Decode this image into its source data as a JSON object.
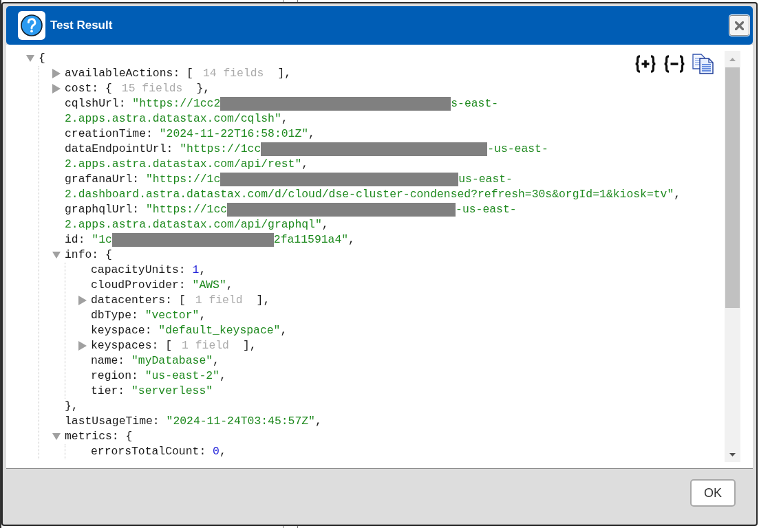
{
  "dialog": {
    "title": "Test Result",
    "tree": {
      "kind": "branch",
      "expanded": true,
      "open": "{",
      "children": [
        {
          "kind": "branch",
          "key": "availableActions:",
          "expanded": false,
          "open": "[",
          "hint": "14 fields",
          "close": "],"
        },
        {
          "kind": "branch",
          "key": "cost:",
          "expanded": false,
          "open": "{",
          "hint": "15 fields",
          "close": "},"
        },
        {
          "kind": "string",
          "key": "cqlshUrl:",
          "lines": [
            [
              {
                "kind": "text",
                "text": "\"https://1cc2"
              },
              {
                "kind": "redaction"
              },
              {
                "kind": "text",
                "text": "s-east-"
              }
            ],
            [
              {
                "kind": "text",
                "text": "2.apps.astra.datastax.com/cqlsh\""
              }
            ]
          ],
          "punct": ","
        },
        {
          "kind": "string",
          "key": "creationTime:",
          "value": "\"2024-11-22T16:58:01Z\"",
          "punct": ","
        },
        {
          "kind": "string",
          "key": "dataEndpointUrl:",
          "lines": [
            [
              {
                "kind": "text",
                "text": "\"https://1cc"
              },
              {
                "kind": "redaction"
              },
              {
                "kind": "text",
                "text": "-us-east-"
              }
            ],
            [
              {
                "kind": "text",
                "text": "2.apps.astra.datastax.com/api/rest\""
              }
            ]
          ],
          "punct": ","
        },
        {
          "kind": "string",
          "key": "grafanaUrl:",
          "lines": [
            [
              {
                "kind": "text",
                "text": "\"https://1c"
              },
              {
                "kind": "redaction"
              },
              {
                "kind": "text",
                "text": "us-east-"
              }
            ],
            [
              {
                "kind": "text",
                "text": "2.dashboard.astra.datastax.com/d/cloud/dse-cluster-condensed?refresh=30s&orgId=1&kiosk=tv\""
              }
            ]
          ],
          "punct": ","
        },
        {
          "kind": "string",
          "key": "graphqlUrl:",
          "lines": [
            [
              {
                "kind": "text",
                "text": "\"https://1cc"
              },
              {
                "kind": "redaction"
              },
              {
                "kind": "text",
                "text": "-us-east-"
              }
            ],
            [
              {
                "kind": "text",
                "text": "2.apps.astra.datastax.com/api/graphql\""
              }
            ]
          ],
          "punct": ","
        },
        {
          "kind": "string",
          "key": "id:",
          "lines": [
            [
              {
                "kind": "text",
                "text": "\"1c"
              },
              {
                "kind": "redaction"
              },
              {
                "kind": "text",
                "text": "2fa11591a4\""
              }
            ]
          ],
          "punct": ","
        },
        {
          "kind": "branch",
          "key": "info:",
          "expanded": true,
          "open": "{",
          "close": "},",
          "children": [
            {
              "kind": "number",
              "key": "capacityUnits:",
              "value": "1",
              "punct": ","
            },
            {
              "kind": "string",
              "key": "cloudProvider:",
              "value": "\"AWS\"",
              "punct": ","
            },
            {
              "kind": "branch",
              "key": "datacenters:",
              "expanded": false,
              "open": "[",
              "hint": "1 field",
              "close": "],"
            },
            {
              "kind": "string",
              "key": "dbType:",
              "value": "\"vector\"",
              "punct": ","
            },
            {
              "kind": "string",
              "key": "keyspace:",
              "value": "\"default_keyspace\"",
              "punct": ","
            },
            {
              "kind": "branch",
              "key": "keyspaces:",
              "expanded": false,
              "open": "[",
              "hint": "1 field",
              "close": "],"
            },
            {
              "kind": "string",
              "key": "name:",
              "value": "\"myDatabase\"",
              "punct": ","
            },
            {
              "kind": "string",
              "key": "region:",
              "value": "\"us-east-2\"",
              "punct": ","
            },
            {
              "kind": "string",
              "key": "tier:",
              "value": "\"serverless\""
            }
          ]
        },
        {
          "kind": "string",
          "key": "lastUsageTime:",
          "value": "\"2024-11-24T03:45:57Z\"",
          "punct": ","
        },
        {
          "kind": "branch",
          "key": "metrics:",
          "expanded": true,
          "open": "{",
          "children": [
            {
              "kind": "number",
              "key": "errorsTotalCount:",
              "value": "0",
              "punct": ","
            }
          ]
        }
      ]
    },
    "buttons": [
      {
        "label": "OK"
      }
    ]
  }
}
